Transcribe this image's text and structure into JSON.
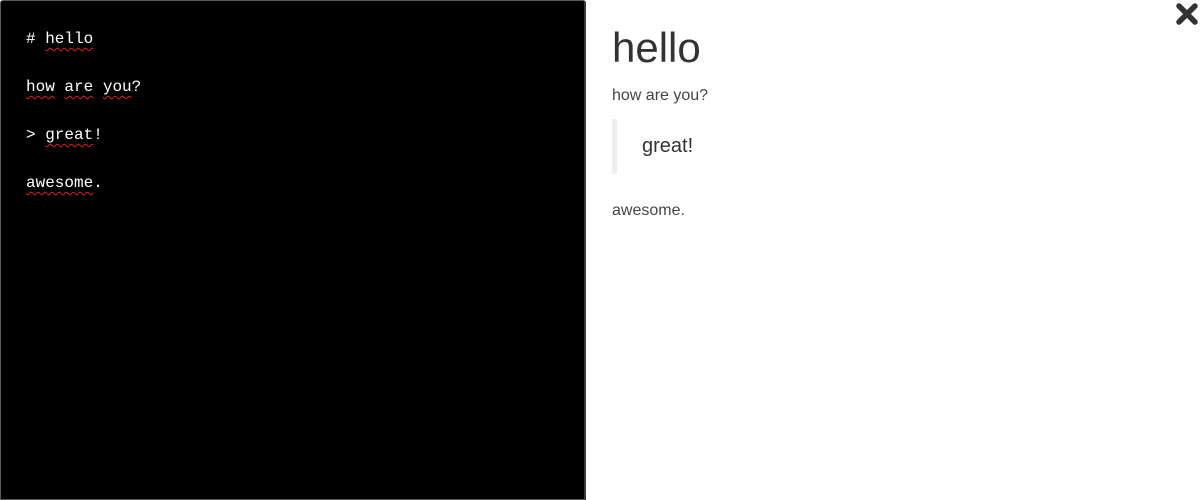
{
  "editor": {
    "lines": [
      {
        "prefix": "# ",
        "word": "hello",
        "suffix": ""
      },
      {
        "words": [
          "how",
          "are",
          "you"
        ],
        "suffix": "?"
      },
      {
        "prefix": "> ",
        "word": "great",
        "suffix": "!"
      },
      {
        "prefix": "",
        "word": "awesome",
        "suffix": "."
      }
    ]
  },
  "preview": {
    "heading": "hello",
    "paragraph1": "how are you?",
    "blockquote": "great!",
    "paragraph2": "awesome."
  },
  "close_button": {
    "icon": "close-icon"
  },
  "colors": {
    "editor_bg": "#000000",
    "editor_text": "#ffffff",
    "spellcheck": "#e02020",
    "preview_text": "#333333",
    "quote_border": "#eeeeee"
  }
}
